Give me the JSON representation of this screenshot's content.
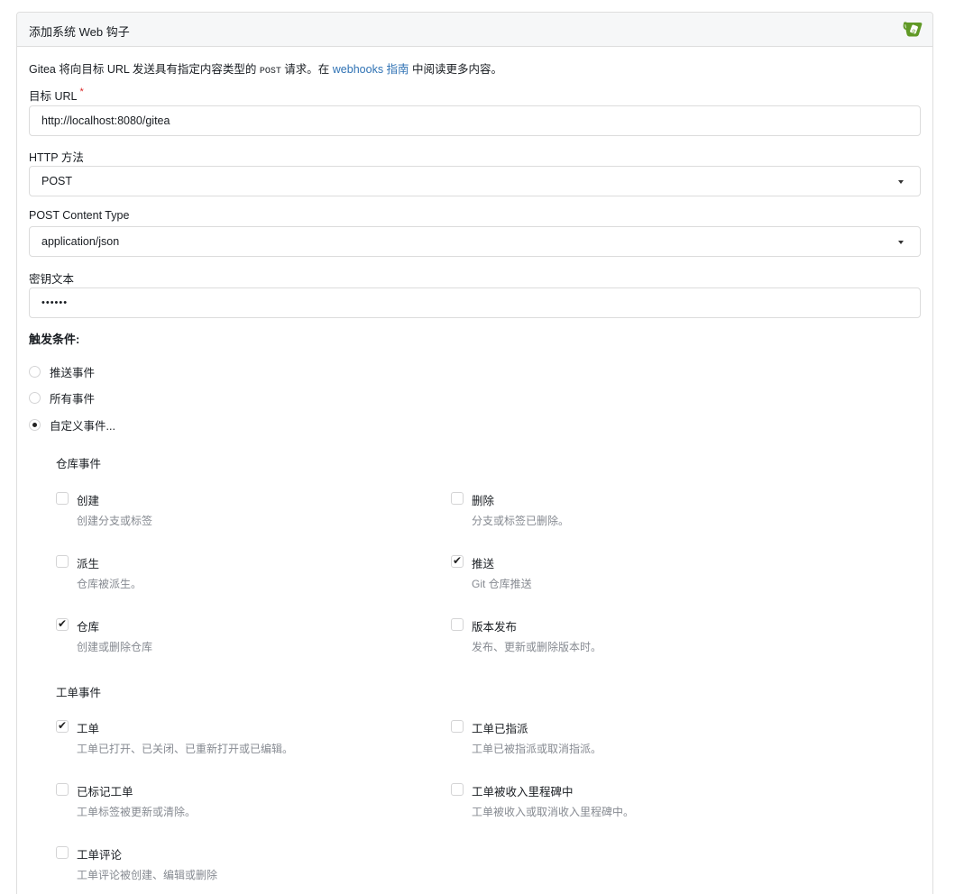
{
  "panel": {
    "title": "添加系统 Web 钩子"
  },
  "description": {
    "prefix": "Gitea 将向目标 URL 发送具有指定内容类型的 ",
    "code": "POST",
    "middle": " 请求。在 ",
    "link": "webhooks 指南",
    "suffix": " 中阅读更多内容。"
  },
  "fields": {
    "target_url": {
      "label": "目标 URL",
      "required_mark": "*",
      "value": "http://localhost:8080/gitea"
    },
    "http_method": {
      "label": "HTTP 方法",
      "value": "POST"
    },
    "content_type": {
      "label": "POST Content Type",
      "value": "application/json"
    },
    "secret": {
      "label": "密钥文本",
      "value": "••••••"
    }
  },
  "trigger": {
    "title": "触发条件:",
    "options": [
      {
        "label": "推送事件",
        "selected": false
      },
      {
        "label": "所有事件",
        "selected": false
      },
      {
        "label": "自定义事件...",
        "selected": true
      }
    ]
  },
  "repo_events": {
    "title": "仓库事件",
    "items": [
      {
        "title": "创建",
        "desc": "创建分支或标签",
        "checked": false
      },
      {
        "title": "删除",
        "desc": "分支或标签已删除。",
        "checked": false
      },
      {
        "title": "派生",
        "desc": "仓库被派生。",
        "checked": false
      },
      {
        "title": "推送",
        "desc": "Git 仓库推送",
        "checked": true
      },
      {
        "title": "仓库",
        "desc": "创建或删除仓库",
        "checked": true
      },
      {
        "title": "版本发布",
        "desc": "发布、更新或删除版本时。",
        "checked": false
      }
    ]
  },
  "issue_events": {
    "title": "工单事件",
    "items": [
      {
        "title": "工单",
        "desc": "工单已打开、已关闭、已重新打开或已编辑。",
        "checked": true
      },
      {
        "title": "工单已指派",
        "desc": "工单已被指派或取消指派。",
        "checked": false
      },
      {
        "title": "已标记工单",
        "desc": "工单标签被更新或清除。",
        "checked": false
      },
      {
        "title": "工单被收入里程碑中",
        "desc": "工单被收入或取消收入里程碑中。",
        "checked": false
      },
      {
        "title": "工单评论",
        "desc": "工单评论被创建、编辑或删除",
        "checked": false
      }
    ]
  },
  "colors": {
    "link": "#2f72b4",
    "required": "#db2828",
    "logo": "#609926",
    "muted": "#868a91"
  }
}
